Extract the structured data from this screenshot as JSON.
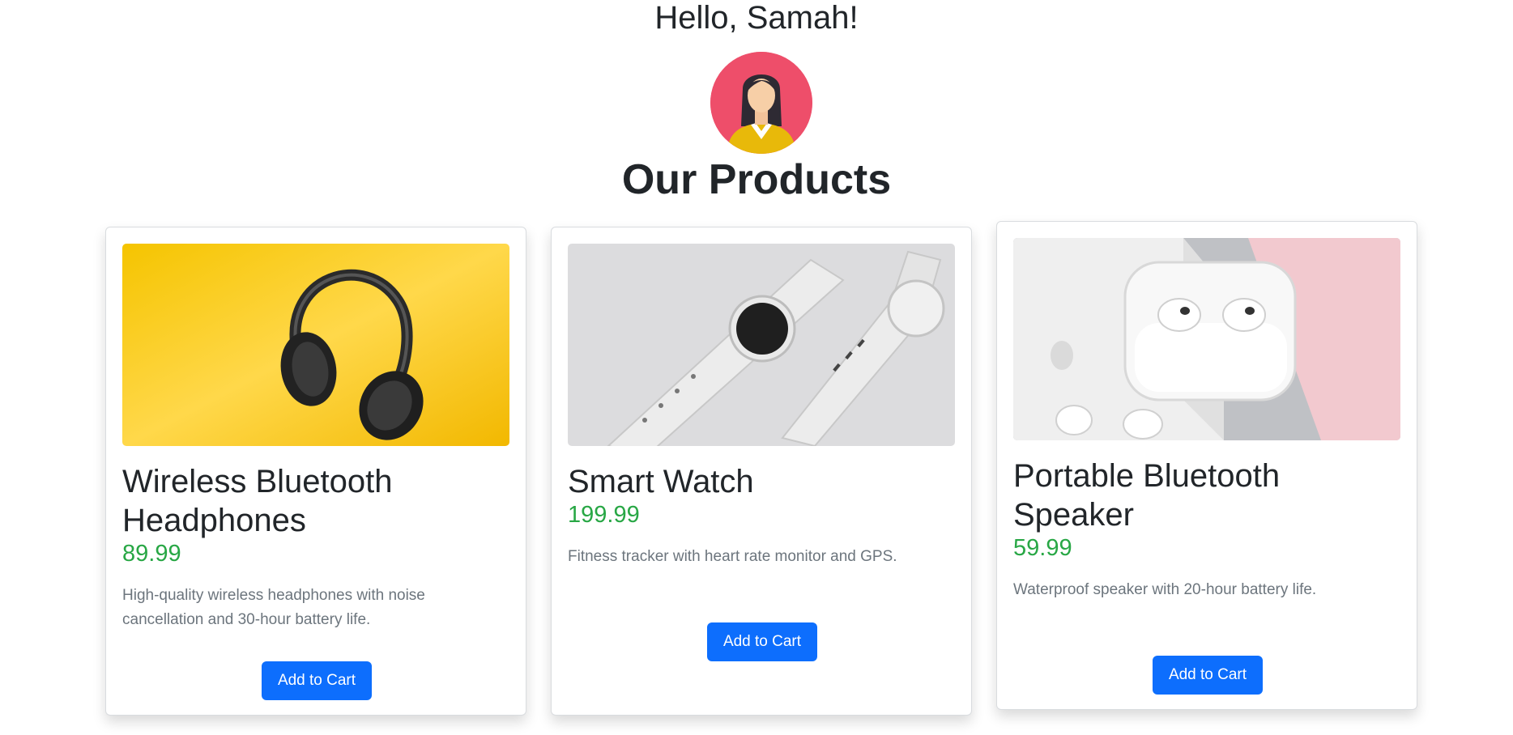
{
  "header": {
    "greeting": "Hello, Samah!",
    "avatar_icon": "woman-avatar-icon",
    "avatar_bg_color": "#ee4e6a"
  },
  "main": {
    "title": "Our Products",
    "products": [
      {
        "title": "Wireless Bluetooth Headphones",
        "price": "89.99",
        "description": "High-quality wireless headphones with noise cancellation and 30-hour battery life.",
        "button_label": "Add to Cart",
        "image": "headphones-image"
      },
      {
        "title": "Smart Watch",
        "price": "199.99",
        "description": "Fitness tracker with heart rate monitor and GPS.",
        "button_label": "Add to Cart",
        "image": "smart-watch-image"
      },
      {
        "title": "Portable Bluetooth Speaker",
        "price": "59.99",
        "description": "Waterproof speaker with 20-hour battery life.",
        "button_label": "Add to Cart",
        "image": "earbuds-image"
      }
    ]
  },
  "colors": {
    "price": "#28a745",
    "button": "#0d6efd",
    "text": "#212529",
    "muted": "#6c757d"
  }
}
